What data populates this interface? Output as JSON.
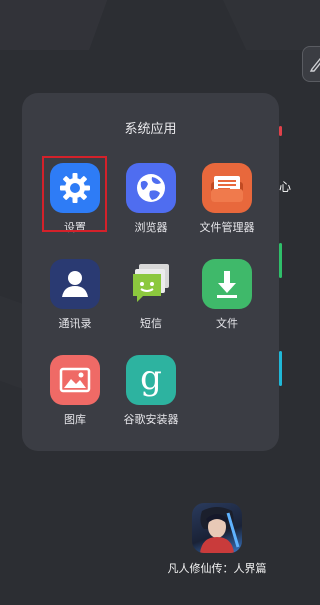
{
  "folder": {
    "title": "系统应用",
    "apps": [
      {
        "label": "设置",
        "icon": "gear-icon",
        "color": "#2e7cf6"
      },
      {
        "label": "浏览器",
        "icon": "globe-icon",
        "color": "#4f6df0"
      },
      {
        "label": "文件管理器",
        "icon": "folder-icon",
        "color": "#e8683c"
      },
      {
        "label": "通讯录",
        "icon": "contacts-icon",
        "color": "#2a3a72"
      },
      {
        "label": "短信",
        "icon": "message-icon",
        "color": "#8cc83e"
      },
      {
        "label": "文件",
        "icon": "download-icon",
        "color": "#3fb96a"
      },
      {
        "label": "图库",
        "icon": "gallery-icon",
        "color": "#ef6a66"
      },
      {
        "label": "谷歌安装器",
        "icon": "google-installer-icon",
        "color": "#2db3a0"
      }
    ]
  },
  "home": {
    "edge_text": "心",
    "game_label": "凡人修仙传：人界篇"
  }
}
